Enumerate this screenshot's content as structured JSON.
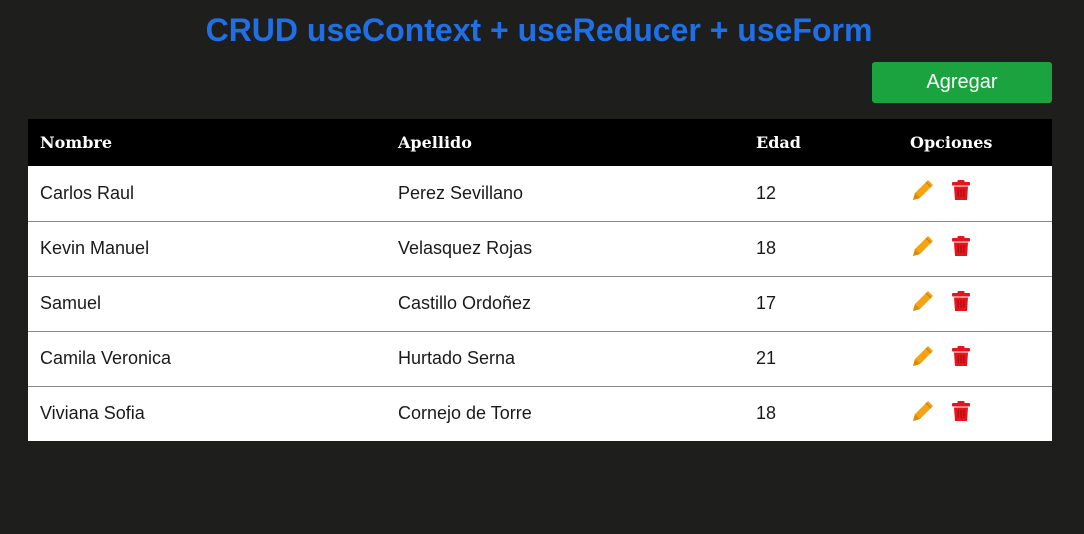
{
  "page": {
    "title": "CRUD useContext + useReducer + useForm"
  },
  "toolbar": {
    "add_label": "Agregar"
  },
  "table": {
    "headers": {
      "nombre": "Nombre",
      "apellido": "Apellido",
      "edad": "Edad",
      "opciones": "Opciones"
    },
    "rows": [
      {
        "nombre": "Carlos Raul",
        "apellido": "Perez Sevillano",
        "edad": "12"
      },
      {
        "nombre": "Kevin Manuel",
        "apellido": "Velasquez Rojas",
        "edad": "18"
      },
      {
        "nombre": "Samuel",
        "apellido": "Castillo Ordoñez",
        "edad": "17"
      },
      {
        "nombre": "Camila Veronica",
        "apellido": "Hurtado Serna",
        "edad": "21"
      },
      {
        "nombre": "Viviana Sofia",
        "apellido": "Cornejo de Torre",
        "edad": "18"
      }
    ],
    "row_icons": [
      "pencil-icon",
      "trash-icon"
    ]
  },
  "colors": {
    "background": "#1e1f1c",
    "title": "#1f6fe6",
    "add_button": "#1aa33e",
    "header_bg": "#000000",
    "edit_icon": "#f5a313",
    "delete_icon": "#e8141b"
  }
}
